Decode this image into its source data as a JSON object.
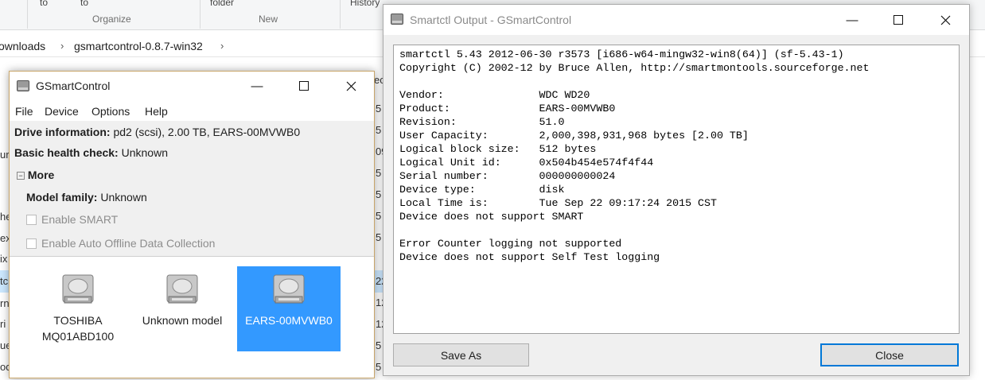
{
  "explorer": {
    "ribbon_fragments": [
      "to",
      "to",
      "folder",
      "History"
    ],
    "groups": [
      "Organize",
      "New"
    ],
    "breadcrumb": [
      "ownloads",
      "gsmartcontrol-0.8.7-win32"
    ],
    "left_fragments": [
      "ur",
      "he",
      "ex",
      "ix",
      "tc",
      "rn",
      "ri",
      "ue",
      "od"
    ],
    "right_fragments": [
      "ec",
      "5",
      "5",
      "09",
      "5",
      "5",
      "5",
      "5",
      "22",
      "12",
      "12",
      "5",
      "5"
    ]
  },
  "main_window": {
    "title": "GSmartControl",
    "menu": [
      "File",
      "Device",
      "Options",
      "Help"
    ],
    "drive_info_label": "Drive information:",
    "drive_info_value": "pd2 (scsi), 2.00 TB, EARS-00MVWB0",
    "health_label": "Basic health check:",
    "health_value": "Unknown",
    "more_label": "More",
    "model_family_label": "Model family:",
    "model_family_value": "Unknown",
    "enable_smart": "Enable SMART",
    "enable_offline": "Enable Auto Offline Data Collection",
    "devices": [
      {
        "line1": "TOSHIBA",
        "line2": "MQ01ABD100",
        "selected": false
      },
      {
        "line1": "Unknown model",
        "line2": "",
        "selected": false
      },
      {
        "line1": "EARS-00MVWB0",
        "line2": "",
        "selected": true
      }
    ]
  },
  "output_window": {
    "title": "Smartctl Output - GSmartControl",
    "text": "smartctl 5.43 2012-06-30 r3573 [i686-w64-mingw32-win8(64)] (sf-5.43-1)\nCopyright (C) 2002-12 by Bruce Allen, http://smartmontools.sourceforge.net\n\nVendor:               WDC WD20\nProduct:              EARS-00MVWB0\nRevision:             51.0\nUser Capacity:        2,000,398,931,968 bytes [2.00 TB]\nLogical block size:   512 bytes\nLogical Unit id:      0x504b454e574f4f44\nSerial number:        000000000024\nDevice type:          disk\nLocal Time is:        Tue Sep 22 09:17:24 2015 CST\nDevice does not support SMART\n\nError Counter logging not supported\nDevice does not support Self Test logging",
    "save_as_label": "Save As",
    "close_label": "Close"
  },
  "colors": {
    "selection": "#3399ff",
    "main_window_border": "#c9a66a",
    "default_button_border": "#0078d7"
  }
}
